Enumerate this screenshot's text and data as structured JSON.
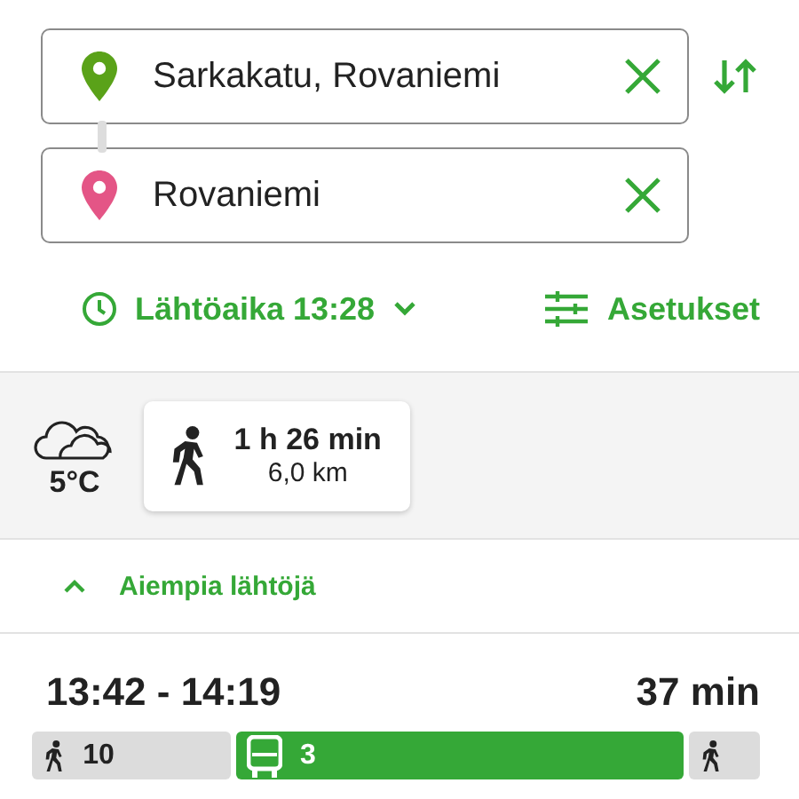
{
  "route": {
    "origin": {
      "value": "Sarkakatu, Rovaniemi"
    },
    "destination": {
      "value": "Rovaniemi"
    }
  },
  "options": {
    "departure": "Lähtöaika 13:28",
    "settings": "Asetukset"
  },
  "weather": {
    "temperature": "5°C"
  },
  "walk_option": {
    "duration": "1 h 26 min",
    "distance": "6,0 km"
  },
  "earlier": "Aiempia lähtöjä",
  "itineraries": [
    {
      "times": "13:42 - 14:19",
      "duration": "37 min",
      "legs": [
        {
          "kind": "walk",
          "label": "10"
        },
        {
          "kind": "bus",
          "label": "3"
        },
        {
          "kind": "walk"
        }
      ]
    }
  ]
}
